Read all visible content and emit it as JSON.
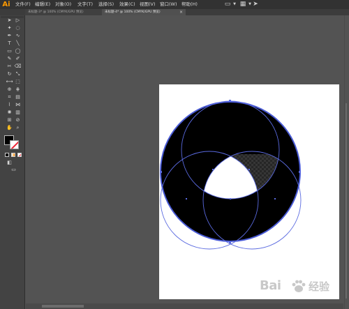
{
  "app": {
    "logo": "Ai"
  },
  "menu": {
    "file": "文件(F)",
    "edit": "编辑(E)",
    "object": "对象(O)",
    "text": "文字(T)",
    "select": "选择(S)",
    "effect": "效果(C)",
    "view": "视图(V)",
    "window": "窗口(W)",
    "help": "帮助(H)"
  },
  "toolbar_icons": [
    "layout-icon",
    "grid-icon",
    "send-icon"
  ],
  "tabs": [
    {
      "label": "未标题-3* @ 100% (CMYK/GPU 预览)",
      "active": false
    },
    {
      "label": "未标题-4* @ 100% (CMYK/GPU 预览)",
      "active": true,
      "close": "×"
    }
  ],
  "artwork": {
    "outer_fill": "#000000",
    "path_stroke": "#4a5bd6",
    "center_fill": "#ffffff",
    "shape": "three overlapping circles inside a large circle"
  },
  "watermark": {
    "text": "Bai",
    "text_cn": "经验"
  }
}
